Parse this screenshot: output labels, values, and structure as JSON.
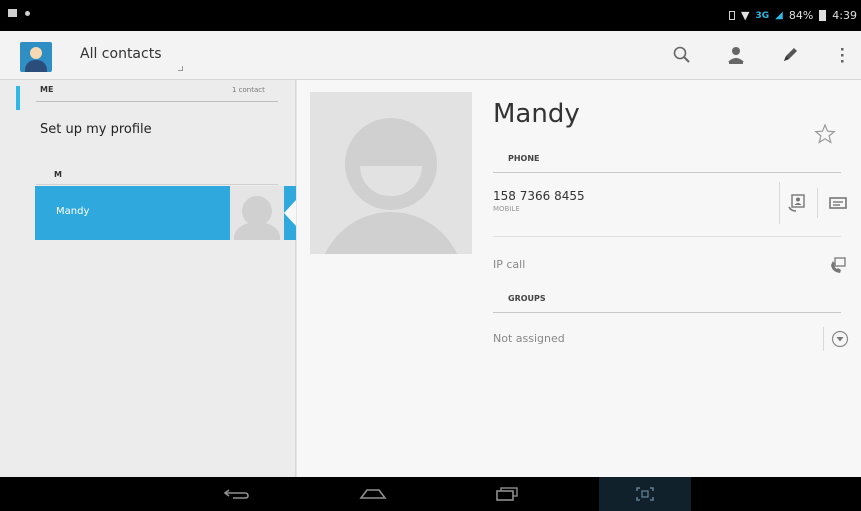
{
  "status_bar": {
    "network_label": "3G",
    "battery": "84%",
    "time": "4:39"
  },
  "action_bar": {
    "title": "All contacts",
    "actions": {
      "search": "search-icon",
      "add_contact": "add-contact-icon",
      "edit": "edit-pencil-icon",
      "overflow": "overflow-menu-icon"
    }
  },
  "contact_list": {
    "me_header": "ME",
    "me_count": "1 contact",
    "setup_profile": "Set up my profile",
    "section_letter": "M",
    "contacts": [
      {
        "name": "Mandy"
      }
    ]
  },
  "detail": {
    "name": "Mandy",
    "phone_header": "PHONE",
    "phone_number": "158 7366 8455",
    "phone_type": "MOBILE",
    "ip_call": "IP call",
    "groups_header": "GROUPS",
    "group_value": "Not assigned"
  },
  "colors": {
    "accent": "#2fa9dd",
    "action_bar_bg": "#f3f3f3",
    "detail_bg": "#f7f7f7"
  }
}
